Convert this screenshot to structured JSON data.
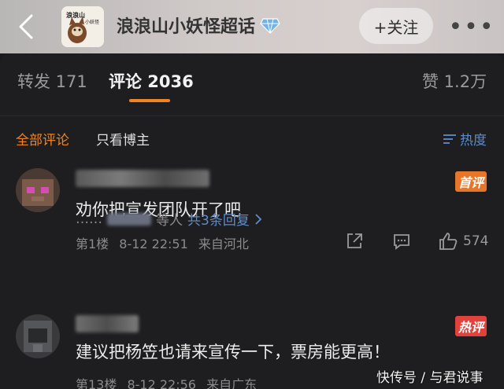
{
  "header": {
    "title": "浪浪山小妖怪超话",
    "logo_text": "浪浪山小妖怪",
    "follow_label": "+关注",
    "more_label": "•••"
  },
  "tabs": [
    {
      "label": "转发 171"
    },
    {
      "label": "评论 2036"
    },
    {
      "label": "赞 1.2万"
    }
  ],
  "filters": {
    "all": "全部评论",
    "author_only": "只看博主",
    "sort": "热度"
  },
  "comments": [
    {
      "badge": "首评",
      "text": "劝你把宣发团队开了吧",
      "floor": "第1楼",
      "time": "8-12 22:51",
      "location": "来自河北",
      "likes": "574",
      "reply_prefix": "……",
      "reply_suffix": "等人",
      "reply_link": "共3条回复"
    },
    {
      "badge": "热评",
      "text": "建议把杨笠也请来宣传一下，票房能更高！",
      "floor": "第13楼",
      "time": "8-12 22:56",
      "location": "来自广东"
    }
  ],
  "watermark": "快传号 / 与君说事",
  "colors": {
    "accent": "#f08324",
    "link": "#5e8cc9",
    "background": "#1e1e20"
  }
}
